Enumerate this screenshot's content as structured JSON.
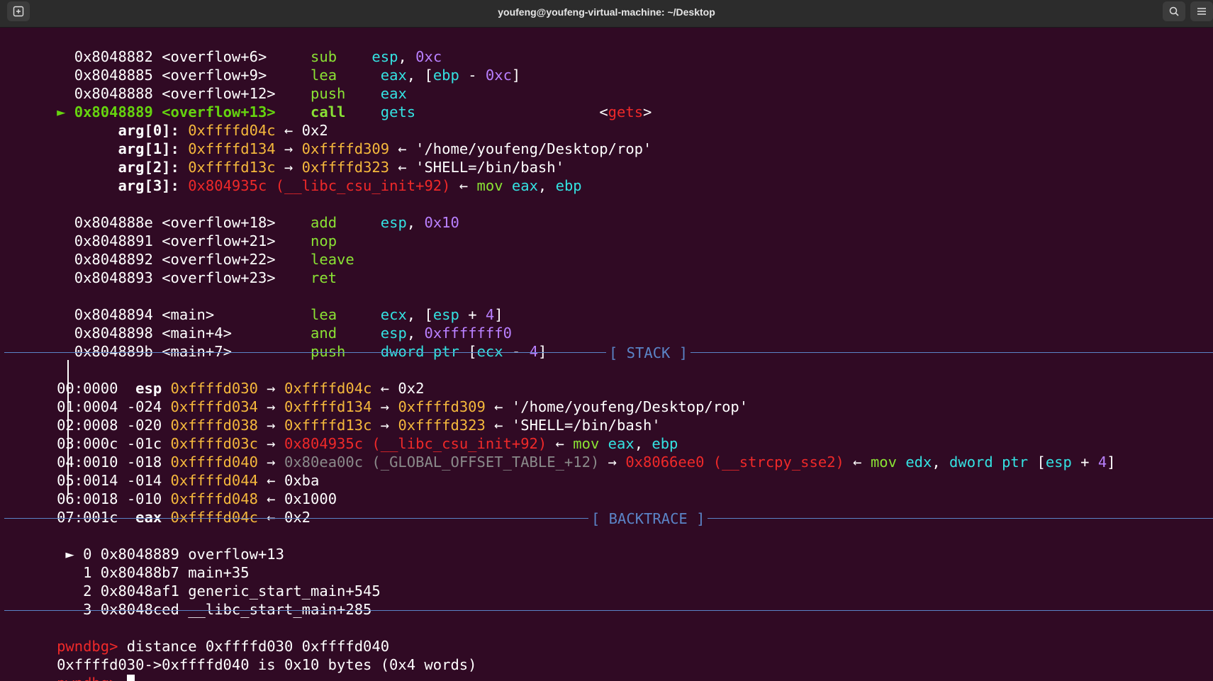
{
  "window": {
    "title": "youfeng@youfeng-virtual-machine: ~/Desktop"
  },
  "disasm": [
    {
      "addr": "0x8048882",
      "sym": "<overflow+6>",
      "mn": "sub",
      "ops": "esp, 0xc"
    },
    {
      "addr": "0x8048885",
      "sym": "<overflow+9>",
      "mn": "lea",
      "ops": "eax, [ebp - 0xc]"
    },
    {
      "addr": "0x8048888",
      "sym": "<overflow+12>",
      "mn": "push",
      "ops": "eax"
    },
    {
      "addr": "0x8048889",
      "sym": "<overflow+13>",
      "mn": "call",
      "ops": "gets",
      "target": "<gets>",
      "current_marker": "►"
    },
    {
      "addr": "0x804888e",
      "sym": "<overflow+18>",
      "mn": "add",
      "ops": "esp, 0x10"
    },
    {
      "addr": "0x8048891",
      "sym": "<overflow+21>",
      "mn": "nop",
      "ops": ""
    },
    {
      "addr": "0x8048892",
      "sym": "<overflow+22>",
      "mn": "leave",
      "ops": ""
    },
    {
      "addr": "0x8048893",
      "sym": "<overflow+23>",
      "mn": "ret",
      "ops": ""
    },
    {
      "addr": "0x8048894",
      "sym": "<main>",
      "mn": "lea",
      "ops": "ecx, [esp + 4]"
    },
    {
      "addr": "0x8048898",
      "sym": "<main+4>",
      "mn": "and",
      "ops": "esp, 0xfffffff0"
    },
    {
      "addr": "0x804889b",
      "sym": "<main+7>",
      "mn": "push",
      "ops": "dword ptr [ecx - 4]"
    }
  ],
  "args": [
    {
      "label": "arg[0]:",
      "text": "0xffffd04c ← 0x2"
    },
    {
      "label": "arg[1]:",
      "text": "0xffffd134 → 0xffffd309 ← '/home/youfeng/Desktop/rop'"
    },
    {
      "label": "arg[2]:",
      "text": "0xffffd13c → 0xffffd323 ← 'SHELL=/bin/bash'"
    },
    {
      "label": "arg[3]:",
      "text": "0x804935c (__libc_csu_init+92) ← mov eax, ebp"
    }
  ],
  "stack_header": "[ STACK ]",
  "stack": [
    {
      "idx": "00:0000",
      "off": "esp",
      "text": "0xffffd030 → 0xffffd04c ← 0x2"
    },
    {
      "idx": "01:0004",
      "off": "-024",
      "text": "0xffffd034 → 0xffffd134 → 0xffffd309 ← '/home/youfeng/Desktop/rop'"
    },
    {
      "idx": "02:0008",
      "off": "-020",
      "text": "0xffffd038 → 0xffffd13c → 0xffffd323 ← 'SHELL=/bin/bash'"
    },
    {
      "idx": "03:000c",
      "off": "-01c",
      "text": "0xffffd03c → 0x804935c (__libc_csu_init+92) ← mov eax, ebp"
    },
    {
      "idx": "04:0010",
      "off": "-018",
      "text": "0xffffd040 → 0x80ea00c (_GLOBAL_OFFSET_TABLE_+12) → 0x8066ee0 (__strcpy_sse2) ← mov edx, dword ptr [esp + 4]"
    },
    {
      "idx": "05:0014",
      "off": "-014",
      "text": "0xffffd044 ← 0xba"
    },
    {
      "idx": "06:0018",
      "off": "-010",
      "text": "0xffffd048 ← 0x1000"
    },
    {
      "idx": "07:001c",
      "off": "eax",
      "text": "0xffffd04c ← 0x2"
    }
  ],
  "backtrace_header": "[ BACKTRACE ]",
  "backtrace": [
    {
      "marker": "►",
      "n": "0",
      "addr": "0x8048889",
      "fn": "overflow+13"
    },
    {
      "marker": "",
      "n": "1",
      "addr": "0x80488b7",
      "fn": "main+35"
    },
    {
      "marker": "",
      "n": "2",
      "addr": "0x8048af1",
      "fn": "generic_start_main+545"
    },
    {
      "marker": "",
      "n": "3",
      "addr": "0x8048ced",
      "fn": "__libc_start_main+285"
    }
  ],
  "console": {
    "prompt": "pwndbg>",
    "command": " distance 0xffffd030 0xffffd040",
    "output": "0xffffd030->0xffffd040 is 0x10 bytes (0x4 words)"
  },
  "colors": {
    "background": "#300a24",
    "address": "#f5b83c",
    "code_ptr": "#ef2929",
    "mnemonic": "#8ae234",
    "register": "#34e2e2",
    "separator": "#5b84c7"
  }
}
